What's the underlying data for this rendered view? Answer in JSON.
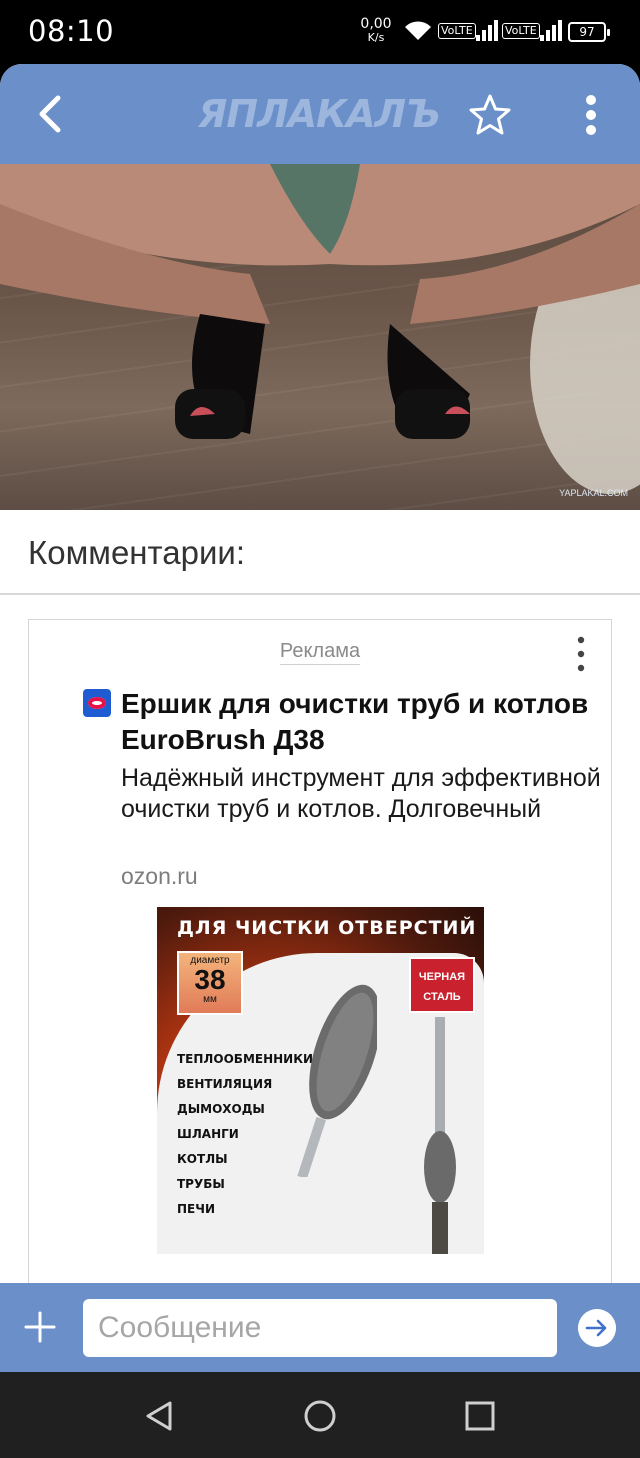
{
  "status_bar": {
    "time": "08:10",
    "net_speed_value": "0,00",
    "net_speed_unit": "K/s",
    "volte1": "VoLTE",
    "volte2": "VoLTE",
    "battery": "97"
  },
  "header": {
    "logo": "ЯПЛАКАЛЪ",
    "back_icon": "chevron-left-icon",
    "star_icon": "star-icon",
    "menu_icon": "more-vertical-icon",
    "color": "#6b8fc8"
  },
  "photo": {
    "watermark": "YAPLAKAL.COM"
  },
  "comments": {
    "title": "Комментарии:"
  },
  "ad": {
    "label": "Реклама",
    "title": "Ершик для очистки труб и котлов EuroBrush Д38",
    "description": "Надёжный инструмент для эффективной очистки труб и котлов. Долговечный",
    "domain": "ozon.ru",
    "image": {
      "headline": "ДЛЯ ЧИСТКИ ОТВЕРСТИЙ",
      "diameter_label": "диаметр",
      "diameter_value": "38",
      "diameter_unit": "мм",
      "steel_line1": "ЧЕРНАЯ",
      "steel_line2": "СТАЛЬ",
      "uses": [
        "ТЕПЛООБМЕННИКИ",
        "ВЕНТИЛЯЦИЯ",
        "ДЫМОХОДЫ",
        "ШЛАНГИ",
        "КОТЛЫ",
        "ТРУБЫ",
        "ПЕЧИ"
      ]
    }
  },
  "compose": {
    "placeholder": "Сообщение",
    "add_icon": "plus-icon",
    "send_icon": "arrow-right-icon"
  },
  "navbar": {
    "back": "triangle-back-icon",
    "home": "circle-home-icon",
    "recents": "square-recents-icon"
  }
}
